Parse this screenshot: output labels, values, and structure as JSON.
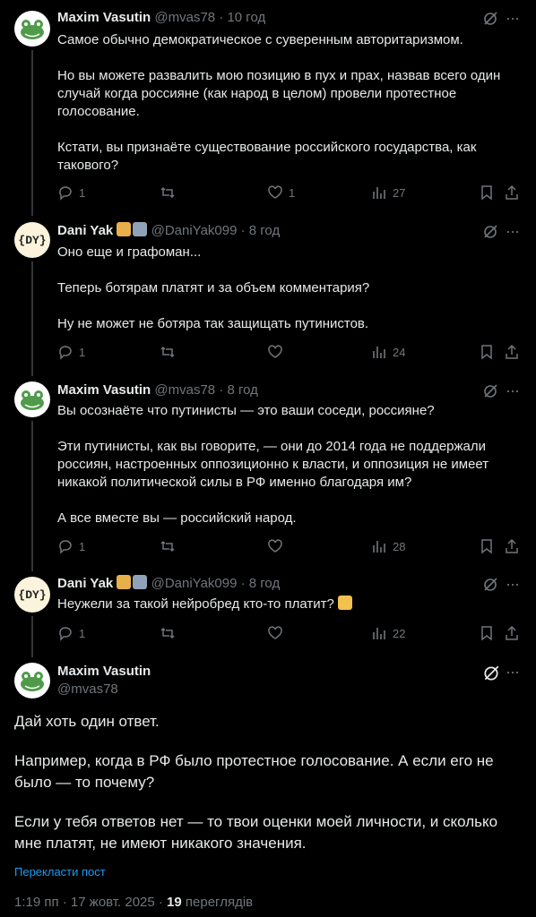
{
  "posts": [
    {
      "name": "Maxim Vasutin",
      "handle": "@mvas78",
      "time": " · 10 год",
      "paragraphs": [
        "Самое обычно демократическое с суверенным авторитаризмом.",
        "Но вы можете развалить мою позицию в пух и прах, назвав всего один случай когда россияне (как народ в целом) провели протестное голосование.",
        "Кстати, вы признаёте существование российского государства, как такового?"
      ],
      "replies": "1",
      "reposts": "",
      "likes": "1",
      "views": "27"
    },
    {
      "name": "Dani Yak",
      "handle": "@DaniYak099",
      "time": " · 8 год",
      "paragraphs": [
        "Оно еще и графоман...",
        "Теперь ботярам платят и за объем комментария?",
        "Ну не может не ботяра так защищать путинистов."
      ],
      "replies": "1",
      "reposts": "",
      "likes": "",
      "views": "24"
    },
    {
      "name": "Maxim Vasutin",
      "handle": "@mvas78",
      "time": " · 8 год",
      "paragraphs": [
        "Вы осознаёте что путинисты — это ваши соседи, россияне?",
        "Эти путинисты, как вы говорите, — они до 2014 года не поддержали россиян, настроенных оппозиционно к власти, и оппозиция не имеет никакой политической силы в РФ именно благодаря им?",
        "А все вместе вы — российский народ."
      ],
      "replies": "1",
      "reposts": "",
      "likes": "",
      "views": "28"
    },
    {
      "name": "Dani Yak",
      "handle": "@DaniYak099",
      "time": " · 8 год",
      "paragraphs": [
        "Неужели за такой нейробред кто-то платит?"
      ],
      "replies": "1",
      "reposts": "",
      "likes": "",
      "views": "22"
    }
  ],
  "main_post": {
    "name": "Maxim Vasutin",
    "handle": "@mvas78",
    "paragraphs": [
      "Дай хоть один ответ.",
      "Например, когда в РФ было протестное голосование. А если его не было — то почему?",
      "Если у тебя ответов нет — то твои оценки моей личности, и сколько мне платят, не имеют никакого значения."
    ],
    "translate_label": "Перекласти пост",
    "timestamp": "1:19 пп · 17 жовт. 2025 · ",
    "views_count": "19",
    "views_label": " переглядів"
  },
  "avatars": {
    "frog": "frog-icon",
    "dy": "{DY}"
  },
  "colors": {
    "background": "#000000",
    "text": "#e7e9ea",
    "muted": "#71767b",
    "link": "#1d9bf0",
    "divider": "#2f3336"
  }
}
